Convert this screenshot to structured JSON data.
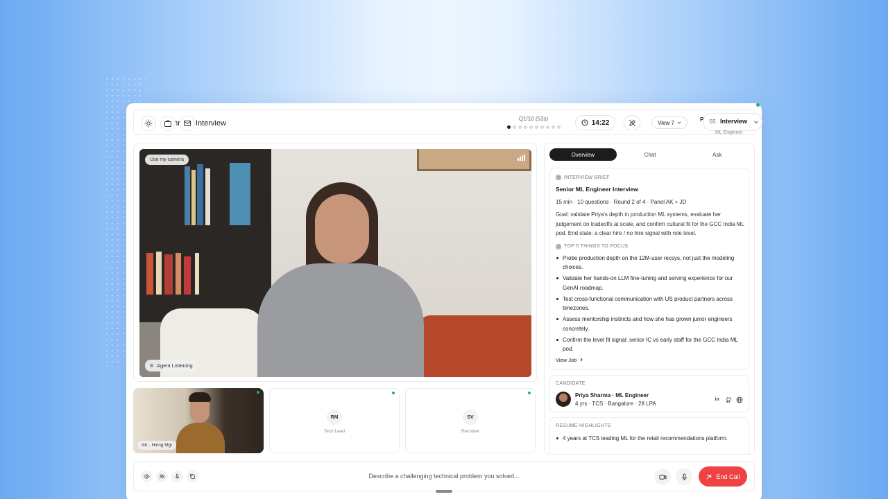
{
  "header": {
    "title": "Technical Interview",
    "question_progress": "Q1/10 (53s)",
    "question_total": 10,
    "question_current": 1,
    "timer": "14:22",
    "view_label": "View 7",
    "pa_label": "Pa",
    "session_code": "S5",
    "session_label": "Interview",
    "session_sub": "ML Engineer"
  },
  "main_video": {
    "use_camera": "Use my camera",
    "agent_status": "Agent Listening"
  },
  "participants": [
    {
      "label": "AK · Hiring Mgr"
    },
    {
      "initials": "RM",
      "role": "Tech Lead"
    },
    {
      "initials": "SV",
      "role": "Recruiter"
    }
  ],
  "tabs": [
    "Overview",
    "Chat",
    "Ask"
  ],
  "brief": {
    "heading": "INTERVIEW BRIEF",
    "title": "Senior ML Engineer Interview",
    "meta": "15 min · 10 questions · Round 2 of 4 · Panel AK + JD",
    "goal": "Goal: validate Priya's depth in production ML systems, evaluate her judgement on tradeoffs at scale, and confirm cultural fit for the GCC India ML pod. End state: a clear hire / no hire signal with role level.",
    "focus_heading": "TOP 5 THINGS TO FOCUS",
    "focus": [
      "Probe production depth on the 12M-user recsys, not just the modeling choices.",
      "Validate her hands-on LLM fine-tuning and serving experience for our GenAI roadmap.",
      "Test cross-functional communication with US product partners across timezones.",
      "Assess mentorship instincts and how she has grown junior engineers concretely.",
      "Confirm the level fit signal: senior IC vs early staff for the GCC India ML pod."
    ],
    "view_job": "View Job"
  },
  "candidate": {
    "heading": "CANDIDATE",
    "name": "Priya Sharma · ML Engineer",
    "meta": "4 yrs · TCS · Bangalore · 28 LPA",
    "linkedin_label": "in"
  },
  "resume": {
    "heading": "RESUME HIGHLIGHTS",
    "items": [
      "4 years at TCS leading ML for the retail recommendations platform."
    ]
  },
  "bottom": {
    "prompt": "Describe a challenging technical problem you solved...",
    "end_call": "End Call"
  },
  "colors": {
    "accent": "#1c1c1c",
    "end_call": "#ef4343",
    "online": "#1fb36a"
  }
}
